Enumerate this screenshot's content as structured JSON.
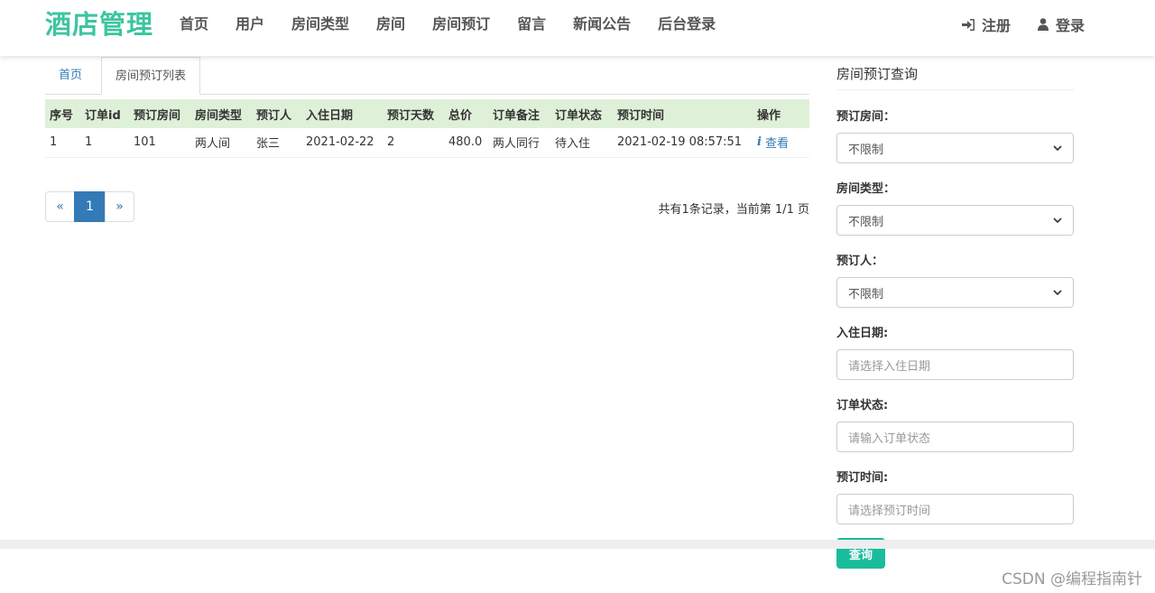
{
  "brand": "酒店管理",
  "nav": {
    "items": [
      "首页",
      "用户",
      "房间类型",
      "房间",
      "房间预订",
      "留言",
      "新闻公告",
      "后台登录"
    ],
    "register": "注册",
    "login": "登录"
  },
  "tabs": {
    "home": "首页",
    "list": "房间预订列表"
  },
  "table": {
    "headers": [
      "序号",
      "订单id",
      "预订房间",
      "房间类型",
      "预订人",
      "入住日期",
      "预订天数",
      "总价",
      "订单备注",
      "订单状态",
      "预订时间",
      "操作"
    ],
    "rows": [
      {
        "index": "1",
        "order_id": "1",
        "room": "101",
        "room_type": "两人间",
        "booker": "张三",
        "checkin": "2021-02-22",
        "days": "2",
        "total": "480.0",
        "remark": "两人同行",
        "status": "待入住",
        "booked_at": "2021-02-19 08:57:51",
        "action": "查看"
      }
    ]
  },
  "pagination": {
    "prev": "«",
    "current": "1",
    "next": "»",
    "info": "共有1条记录，当前第 1/1 页"
  },
  "sidebar": {
    "title": "房间预订查询",
    "fields": {
      "room": {
        "label": "预订房间：",
        "value": "不限制"
      },
      "room_type": {
        "label": "房间类型：",
        "value": "不限制"
      },
      "booker": {
        "label": "预订人：",
        "value": "不限制"
      },
      "checkin": {
        "label": "入住日期:",
        "placeholder": "请选择入住日期"
      },
      "status": {
        "label": "订单状态:",
        "placeholder": "请输入订单状态"
      },
      "booked_at": {
        "label": "预订时间:",
        "placeholder": "请选择预订时间"
      }
    },
    "query_button": "查询"
  },
  "watermark": "CSDN @编程指南针",
  "colors": {
    "brand": "#3cc5a0",
    "link": "#337ab7",
    "header_bg": "#dff0d8",
    "query_btn": "#1abc9c"
  }
}
